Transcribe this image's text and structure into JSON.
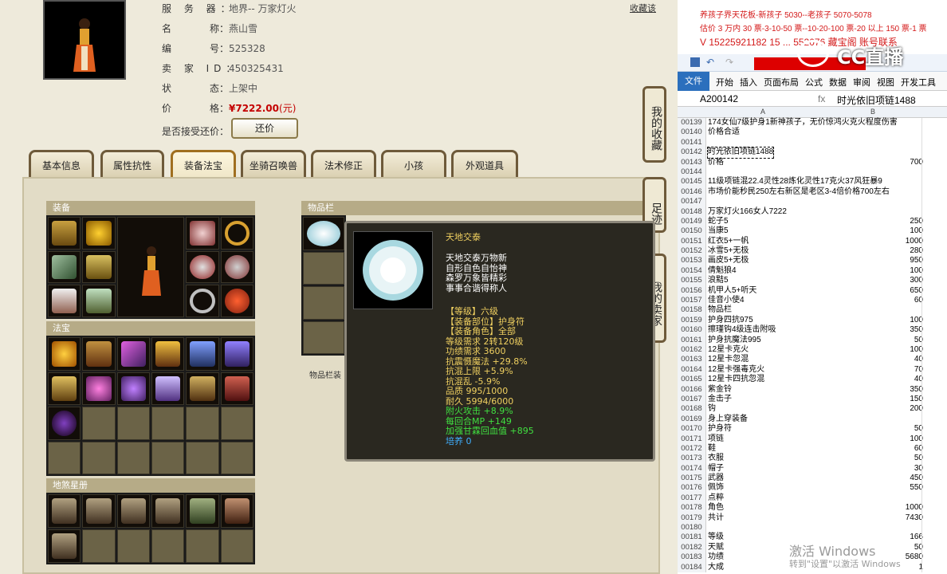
{
  "header": {
    "fav_link": "收藏该",
    "server_label": "服 务 器：",
    "server_value": "地界-- 万家灯火",
    "name_label": "名",
    "name_label2": "称：",
    "name_value": "燕山雪",
    "id_label": "编",
    "id_label2": "号：",
    "id_value": "525328",
    "seller_label": "卖 家 ID：",
    "seller_value": "450325431",
    "status_label": "状",
    "status_label2": "态：",
    "status_value": "上架中",
    "price_label": "价",
    "price_label2": "格：",
    "price_value": "¥7222.00",
    "price_unit": "(元)",
    "accept_counter_label": "是否接受还价：",
    "counter_button": "还价"
  },
  "tabs": [
    "基本信息",
    "属性抗性",
    "装备法宝",
    "坐骑召唤兽",
    "法术修正",
    "小孩",
    "外观道具"
  ],
  "active_tab_index": 2,
  "panels": {
    "equipment_title": "装备",
    "fabao_title": "法宝",
    "tiansha_title": "地煞星册",
    "items_title": "物品栏",
    "items_note": "物品栏装"
  },
  "side_buttons": [
    "我的收藏",
    "足迹",
    "我的卖家"
  ],
  "tooltip": {
    "name": "天地交泰",
    "desc": [
      "天地交泰万物新",
      "自形自色自怡神",
      "森罗万象皆精彩",
      "事事合谐得称人"
    ],
    "level": "【等级】六级",
    "slot": "【装备部位】护身符",
    "role": "【装备角色】全部",
    "req_level": "等级需求 2转120级",
    "req_merit": "功绩需求 3600",
    "stat1": "抗震慑魔法 +29.8%",
    "stat2": "抗混上限 +5.9%",
    "stat3": "抗混乱 -5.9%",
    "quality": "品质 995/1000",
    "durability": "耐久 5994/6000",
    "bonus1": "附火攻击 +8.9%",
    "bonus2": "每回合MP +149",
    "bonus3": "加强甘霖回血值 +895",
    "nurture": "培养 0"
  },
  "excel": {
    "notes": [
      "养孩子界天花板-新孩子 5030--老孩子 5070-5078",
      "估价 3 万内 30 票-3-10-50 票--10-20-100 票-20 以上 150 票-1 票",
      "V 15225921182     15 ... 552076   藏宝阁 账号联系"
    ],
    "logo": "CC直播",
    "menu": [
      "文件",
      "开始",
      "插入",
      "页面布局",
      "公式",
      "数据",
      "审阅",
      "视图",
      "开发工具"
    ],
    "name_box": "A200142",
    "formula": "时光依旧项链1488",
    "col_a": "A",
    "col_b": "B",
    "rows": [
      {
        "n": "00139",
        "a": "174女仙7级护身1新神孩子，无价惊鸿火克火程度伤害",
        "b": ""
      },
      {
        "n": "00140",
        "a": "价格合适",
        "b": ""
      },
      {
        "n": "00141",
        "a": "",
        "b": ""
      },
      {
        "n": "00142",
        "a": "时光依旧项链1488",
        "b": ""
      },
      {
        "n": "00143",
        "a": "价格",
        "b": "700"
      },
      {
        "n": "00144",
        "a": "",
        "b": ""
      },
      {
        "n": "00145",
        "a": "11级项链混22.4灵性28炼化灵性17克火37风狂暴9",
        "b": ""
      },
      {
        "n": "00146",
        "a": "市场价能秒民250左右新区是老区3-4倍价格700左右",
        "b": ""
      },
      {
        "n": "00147",
        "a": "",
        "b": ""
      },
      {
        "n": "00148",
        "a": "万家灯火166女人7222",
        "b": ""
      },
      {
        "n": "00149",
        "a": "蛇子5",
        "b": "250"
      },
      {
        "n": "00150",
        "a": "当康5",
        "b": "100"
      },
      {
        "n": "00151",
        "a": "红衣5+一帆",
        "b": "1000"
      },
      {
        "n": "00152",
        "a": "冰雪5+无极",
        "b": "280"
      },
      {
        "n": "00153",
        "a": "画皮5+无极",
        "b": "950"
      },
      {
        "n": "00154",
        "a": "倩魁狼4",
        "b": "100"
      },
      {
        "n": "00155",
        "a": "浪黠5",
        "b": "300"
      },
      {
        "n": "00156",
        "a": "机甲人5+听天",
        "b": "650"
      },
      {
        "n": "00157",
        "a": "佳音小使4",
        "b": "60"
      },
      {
        "n": "00158",
        "a": "物品栏",
        "b": ""
      },
      {
        "n": "00159",
        "a": "护身四抗975",
        "b": "100"
      },
      {
        "n": "00160",
        "a": "擦瑾钩4级连击附吸",
        "b": "350"
      },
      {
        "n": "00161",
        "a": "护身抗魔法995",
        "b": "50"
      },
      {
        "n": "00162",
        "a": "12星卡克火",
        "b": "100"
      },
      {
        "n": "00163",
        "a": "12星卡忽混",
        "b": "40"
      },
      {
        "n": "00164",
        "a": "12星卡强毒克火",
        "b": "70"
      },
      {
        "n": "00165",
        "a": "12星卡四抗忽混",
        "b": "40"
      },
      {
        "n": "00166",
        "a": "紫金铃",
        "b": "350"
      },
      {
        "n": "00167",
        "a": "金击子",
        "b": "150"
      },
      {
        "n": "00168",
        "a": "钩",
        "b": "200"
      },
      {
        "n": "00169",
        "a": "身上穿装备",
        "b": ""
      },
      {
        "n": "00170",
        "a": "护身符",
        "b": "50"
      },
      {
        "n": "00171",
        "a": "项链",
        "b": "100"
      },
      {
        "n": "00172",
        "a": "鞋",
        "b": "60"
      },
      {
        "n": "00173",
        "a": "衣服",
        "b": "50"
      },
      {
        "n": "00174",
        "a": "帽子",
        "b": "30"
      },
      {
        "n": "00175",
        "a": "武器",
        "b": "450"
      },
      {
        "n": "00176",
        "a": "佩饰",
        "b": "550"
      },
      {
        "n": "00177",
        "a": "点粹",
        "b": ""
      },
      {
        "n": "00178",
        "a": "角色",
        "b": "1000"
      },
      {
        "n": "00179",
        "a": "共计",
        "b": "7430"
      },
      {
        "n": "00180",
        "a": "",
        "b": ""
      },
      {
        "n": "00181",
        "a": "等级",
        "b": "166"
      },
      {
        "n": "00182",
        "a": "天赋",
        "b": "50"
      },
      {
        "n": "00183",
        "a": "功绩",
        "b": "5680"
      },
      {
        "n": "00184",
        "a": "大成",
        "b": "1"
      }
    ]
  },
  "watermark": {
    "line1": "激活 Windows",
    "line2": "转到\"设置\"以激活 Windows"
  }
}
